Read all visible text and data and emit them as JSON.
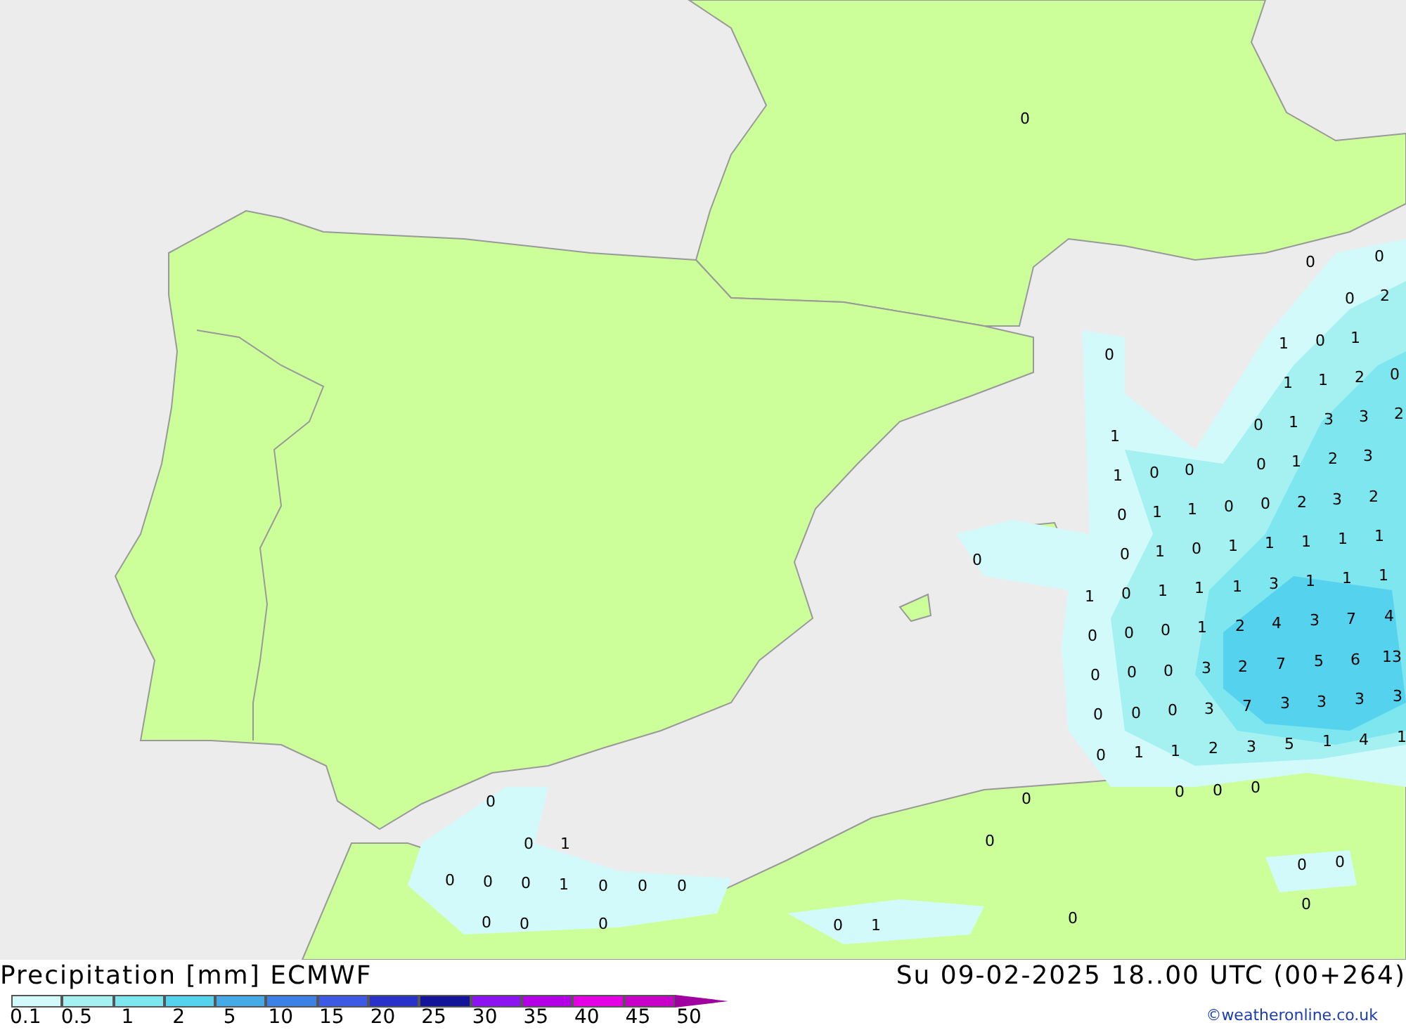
{
  "map": {
    "values": [
      "0",
      "0",
      "0",
      "0",
      "2",
      "1",
      "0",
      "1",
      "0",
      "1",
      "1",
      "2",
      "0",
      "0",
      "1",
      "3",
      "3",
      "2",
      "1",
      "1",
      "0",
      "0",
      "0",
      "1",
      "2",
      "3",
      "0",
      "1",
      "1",
      "0",
      "0",
      "2",
      "3",
      "2",
      "0",
      "1",
      "0",
      "1",
      "1",
      "1",
      "1",
      "1",
      "0",
      "1",
      "0",
      "1",
      "1",
      "1",
      "3",
      "1",
      "1",
      "1",
      "0",
      "0",
      "0",
      "1",
      "2",
      "4",
      "3",
      "7",
      "4",
      "0",
      "0",
      "0",
      "3",
      "2",
      "7",
      "5",
      "6",
      "13",
      "0",
      "0",
      "0",
      "3",
      "7",
      "3",
      "3",
      "3",
      "3",
      "0",
      "1",
      "1",
      "2",
      "3",
      "5",
      "1",
      "4",
      "1",
      "0",
      "0",
      "0",
      "0",
      "0",
      "0",
      "1",
      "0",
      "0",
      "0",
      "0",
      "0",
      "0",
      "1",
      "0",
      "0",
      "0",
      "0",
      "0",
      "0",
      "0",
      "0",
      "1",
      "0"
    ]
  },
  "footer": {
    "title": "Precipitation [mm] ECMWF",
    "datetime": "Su 09-02-2025 18..00 UTC (00+264)",
    "credit": "©weatheronline.co.uk",
    "legend": {
      "ticks": [
        "0.1",
        "0.5",
        "1",
        "2",
        "5",
        "10",
        "15",
        "20",
        "25",
        "30",
        "35",
        "40",
        "45",
        "50"
      ]
    }
  }
}
